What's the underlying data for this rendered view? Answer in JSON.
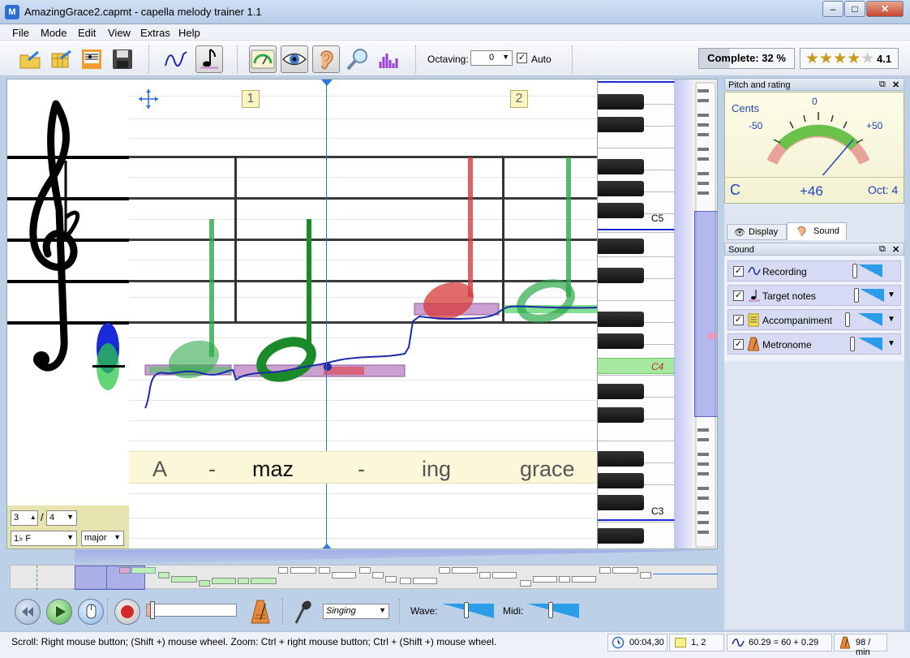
{
  "window": {
    "title": "AmazingGrace2.capmt - capella melody trainer 1.1",
    "app_icon_label": "M"
  },
  "menu": [
    "File",
    "Mode",
    "Edit",
    "View",
    "Extras",
    "Help"
  ],
  "toolbar": {
    "octaving_label": "Octaving:",
    "octaving_value": "0",
    "auto_label": "Auto",
    "complete_label": "Complete: 32 %",
    "rating": "4.1",
    "stars": 4
  },
  "score": {
    "measures": [
      "1",
      "2"
    ],
    "lyrics": [
      "A",
      "-",
      "maz",
      "-",
      "ing",
      "grace"
    ],
    "piano_labels": [
      "C5",
      "C4",
      "C3"
    ],
    "time_sig_num": "3",
    "time_sig_den": "4",
    "key": "F",
    "mode": "major",
    "key_sig_symbol": "1♭"
  },
  "pitch_panel": {
    "title": "Pitch and rating",
    "cents_label": "Cents",
    "scale": [
      "-50",
      "0",
      "+50"
    ],
    "note": "C",
    "cents_value": "+46",
    "octave": "Oct: 4"
  },
  "tabs": [
    {
      "label": "Display",
      "active": false
    },
    {
      "label": "Sound",
      "active": true
    }
  ],
  "sound_panel": {
    "title": "Sound",
    "rows": [
      {
        "label": "Recording",
        "checked": true,
        "dropdown": false
      },
      {
        "label": "Target notes",
        "checked": true,
        "dropdown": true
      },
      {
        "label": "Accompaniment",
        "checked": true,
        "dropdown": true
      },
      {
        "label": "Metronome",
        "checked": true,
        "dropdown": true
      }
    ]
  },
  "transport": {
    "voice": "Singing",
    "wave_label": "Wave:",
    "midi_label": "Midi:"
  },
  "status": {
    "hint": "Scroll: Right mouse button; (Shift +) mouse wheel.  Zoom: Ctrl + right mouse button; Ctrl + (Shift +) mouse wheel.",
    "time": "00:04,30",
    "position": "1, 2",
    "pitch": "60.29 = 60 + 0.29",
    "tempo": "98 / min"
  },
  "colors": {
    "accent": "#2b9ce8",
    "target_note": "#c9a0d0",
    "good": "#2ea84a",
    "bad": "#d83a3a",
    "recording": "#1a2aa8"
  }
}
